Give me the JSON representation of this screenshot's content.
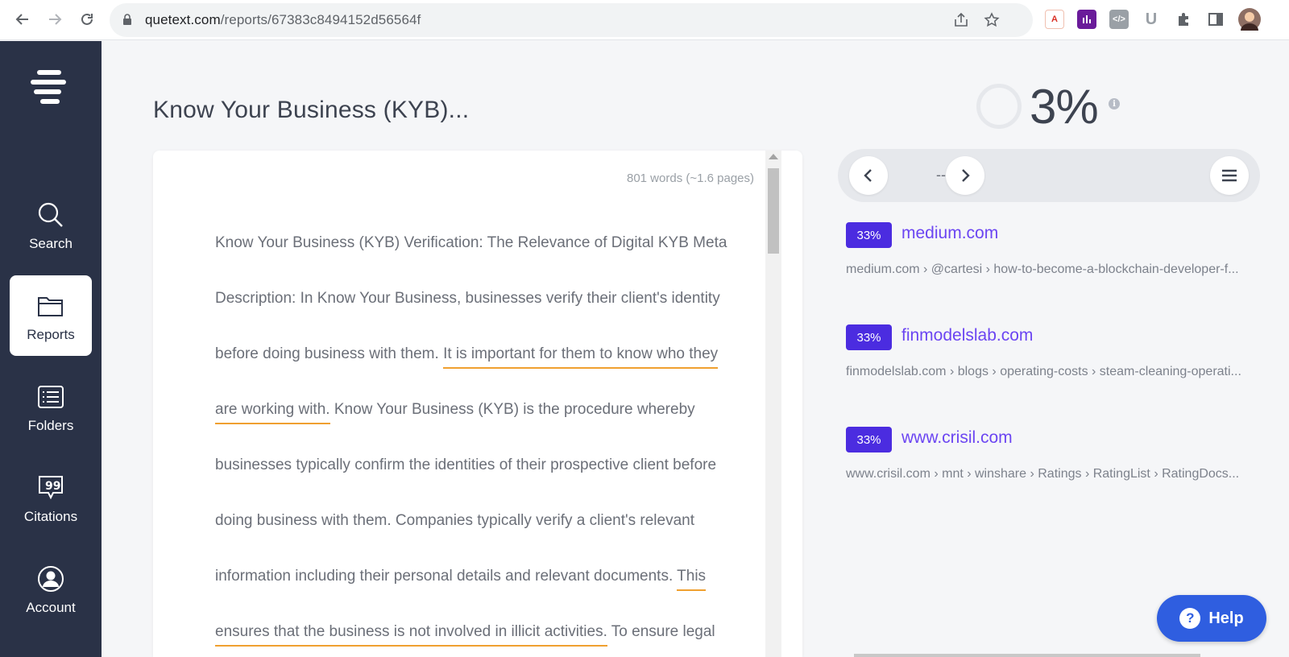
{
  "browser": {
    "url_host": "quetext.com",
    "url_path": "/reports/67383c8494152d56564f"
  },
  "sidebar": {
    "items": [
      {
        "label": "Search",
        "icon": "search-icon",
        "active": false
      },
      {
        "label": "Reports",
        "icon": "folder-icon",
        "active": true
      },
      {
        "label": "Folders",
        "icon": "list-icon",
        "active": false
      },
      {
        "label": "Citations",
        "icon": "quote-bubble-icon",
        "active": false
      },
      {
        "label": "Account",
        "icon": "user-circle-icon",
        "active": false
      }
    ]
  },
  "document": {
    "title": "Know Your Business (KYB)...",
    "word_count": "801 words (~1.6 pages)",
    "segments": [
      "Know Your Business (KYB) Verification: The Relevance of Digital KYB Meta Description: In Know Your Business, businesses verify their client's identity before doing business with them. ",
      "It is important for them to know who they are working with.",
      " Know Your Business (KYB) is the procedure whereby businesses typically confirm the identities of their prospective client before doing business with them. Companies typically verify a client's relevant information including their personal details and relevant documents. ",
      "This ensures that the business is not involved in illicit activities.",
      " To ensure legal"
    ]
  },
  "score": {
    "percent": "3%",
    "value": 3,
    "info_icon": "i"
  },
  "match_nav": {
    "counter": "--"
  },
  "sources": [
    {
      "percent": "33%",
      "name": "medium.com",
      "path": "medium.com › @cartesi › how-to-become-a-blockchain-developer-f..."
    },
    {
      "percent": "33%",
      "name": "finmodelslab.com",
      "path": "finmodelslab.com › blogs › operating-costs › steam-cleaning-operati..."
    },
    {
      "percent": "33%",
      "name": "www.crisil.com",
      "path": "www.crisil.com › mnt › winshare › Ratings › RatingList › RatingDocs..."
    }
  ],
  "help": {
    "label": "Help"
  },
  "colors": {
    "sidebar": "#2a3247",
    "badge": "#4b2ce0",
    "source_link": "#6b45f2",
    "highlight": "#f0a030",
    "help": "#2f5ee0"
  }
}
